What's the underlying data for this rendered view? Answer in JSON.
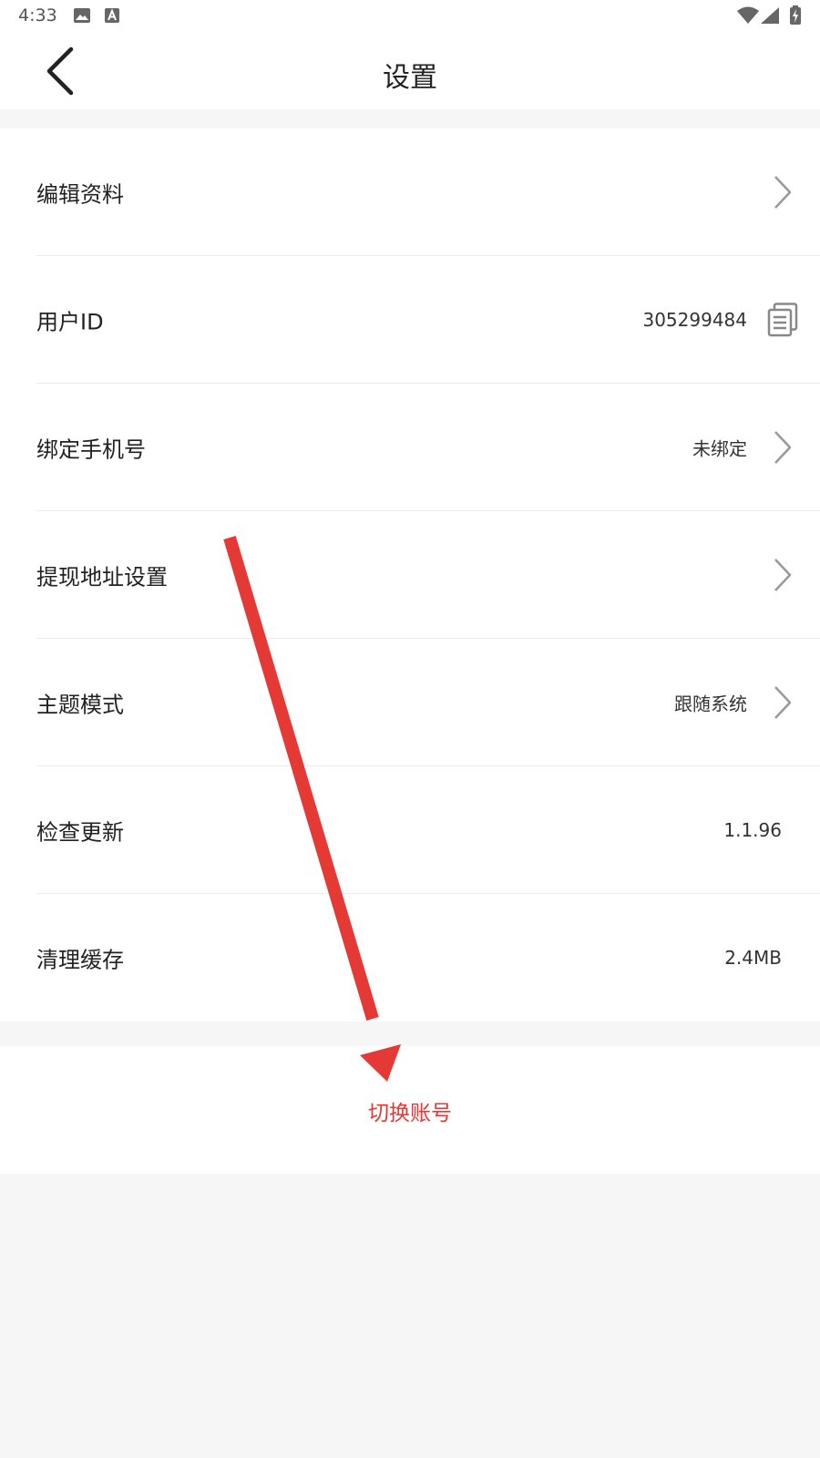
{
  "status_bar": {
    "time": "4:33",
    "icons": [
      "image-icon",
      "text-a-icon",
      "wifi-icon",
      "signal-icon",
      "battery-charging-icon"
    ]
  },
  "header": {
    "title": "设置",
    "back_icon": "chevron-left-icon"
  },
  "settings": {
    "items": [
      {
        "label": "编辑资料",
        "value": "",
        "trailing": "chevron"
      },
      {
        "label": "用户ID",
        "value": "305299484",
        "trailing": "copy"
      },
      {
        "label": "绑定手机号",
        "value": "未绑定",
        "trailing": "chevron"
      },
      {
        "label": "提现地址设置",
        "value": "",
        "trailing": "chevron"
      },
      {
        "label": "主题模式",
        "value": "跟随系统",
        "trailing": "chevron"
      },
      {
        "label": "检查更新",
        "value": "1.1.96",
        "trailing": "none"
      },
      {
        "label": "清理缓存",
        "value": "2.4MB",
        "trailing": "none"
      }
    ]
  },
  "switch_account": {
    "label": "切换账号"
  },
  "colors": {
    "accent_red": "#e53935",
    "background": "#f5f6f5",
    "surface": "#ffffff",
    "divider": "#ececec"
  },
  "annotation": {
    "type": "arrow",
    "color": "#e53935"
  }
}
